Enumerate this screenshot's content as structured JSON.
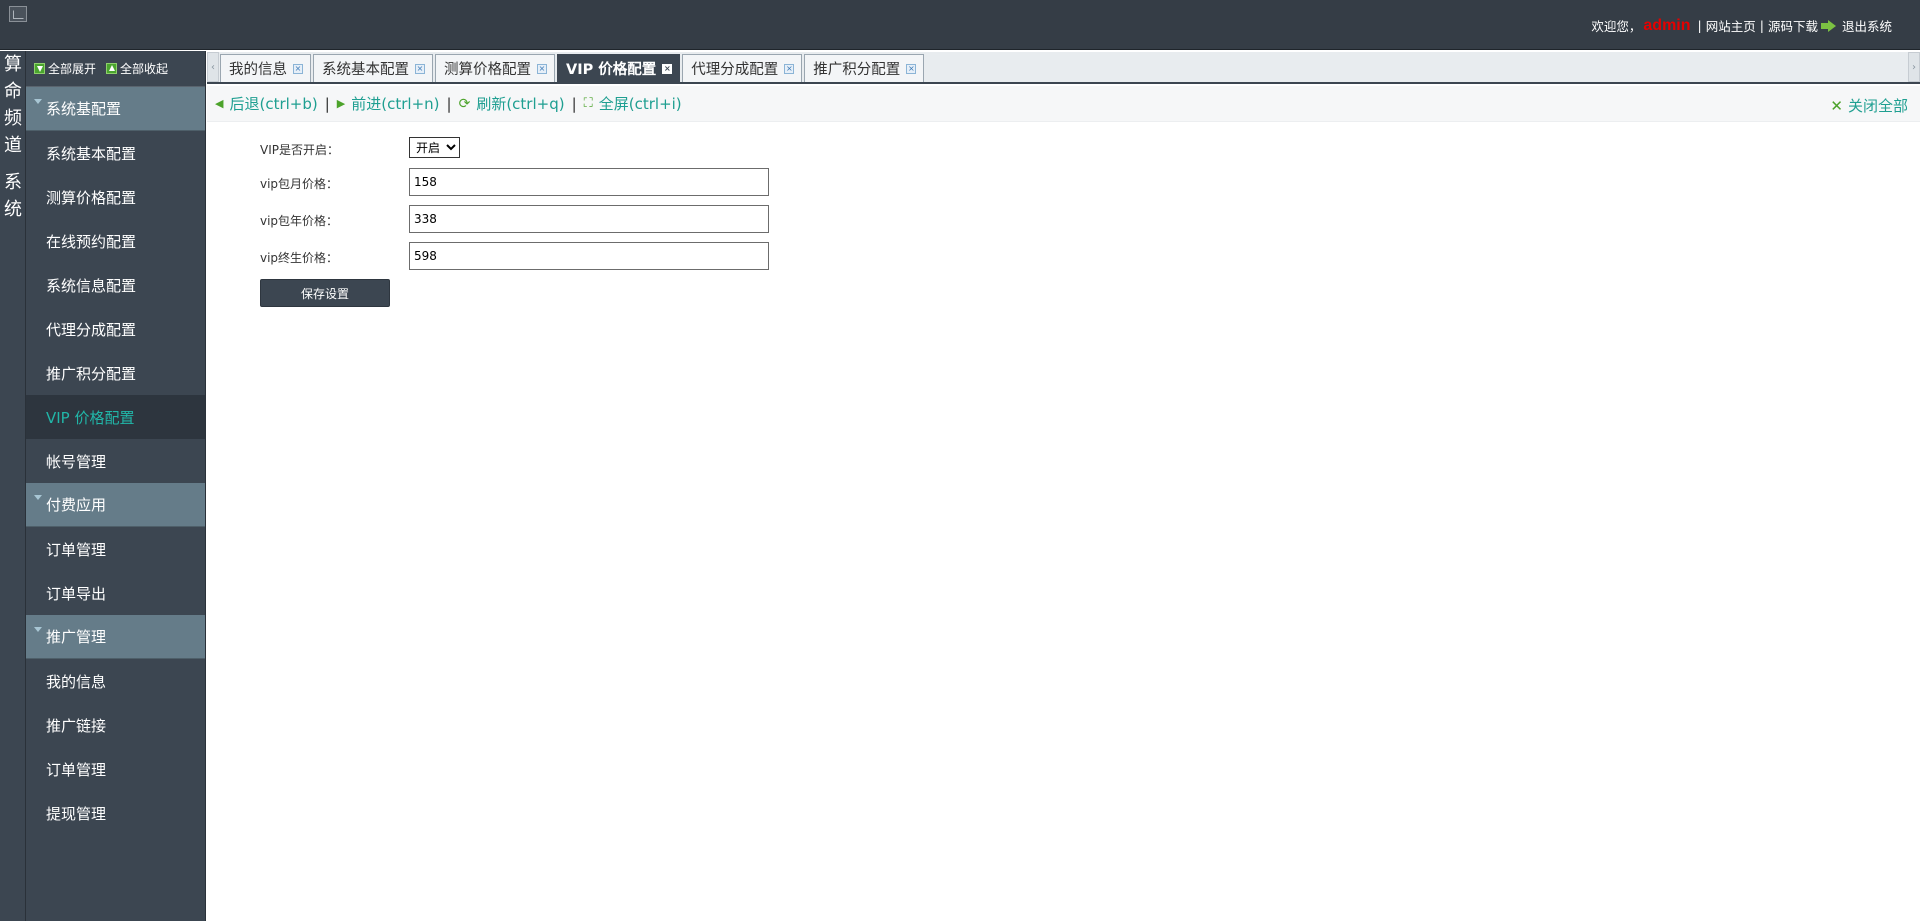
{
  "header": {
    "welcome": "欢迎您，",
    "user": "admin",
    "links": [
      "网站主页",
      "源码下载"
    ],
    "logout": "退出系统"
  },
  "channel": {
    "labels": [
      "算命频道",
      "系统"
    ]
  },
  "sidebar": {
    "expand_all": "全部展开",
    "collapse_all": "全部收起",
    "groups": [
      {
        "title": "系统基配置",
        "items": [
          "系统基本配置",
          "测算价格配置",
          "在线预约配置",
          "系统信息配置",
          "代理分成配置",
          "推广积分配置",
          "VIP 价格配置",
          "帐号管理"
        ]
      },
      {
        "title": "付费应用",
        "items": [
          "订单管理",
          "订单导出"
        ]
      },
      {
        "title": "推广管理",
        "items": [
          "我的信息",
          "推广链接",
          "订单管理",
          "提现管理"
        ]
      }
    ],
    "active_item": "VIP 价格配置"
  },
  "tabs": [
    {
      "label": "我的信息",
      "active": false
    },
    {
      "label": "系统基本配置",
      "active": false
    },
    {
      "label": "测算价格配置",
      "active": false
    },
    {
      "label": "VIP 价格配置",
      "active": true
    },
    {
      "label": "代理分成配置",
      "active": false
    },
    {
      "label": "推广积分配置",
      "active": false
    }
  ],
  "toolbar": {
    "back": "后退(ctrl+b)",
    "forward": "前进(ctrl+n)",
    "refresh": "刷新(ctrl+q)",
    "fullscreen": "全屏(ctrl+i)",
    "separator": "|",
    "close_all": "关闭全部"
  },
  "form": {
    "vip_enabled_label": "VIP是否开启：",
    "vip_enabled_value": "开启",
    "monthly_label": "vip包月价格：",
    "monthly_value": "158",
    "yearly_label": "vip包年价格：",
    "yearly_value": "338",
    "lifetime_label": "vip终生价格：",
    "lifetime_value": "598",
    "save_label": "保存设置"
  },
  "colors": {
    "header_bg": "#353d46",
    "sidebar_bg": "#3c4651",
    "group_bg": "#657c89",
    "active_text": "#21b6a8",
    "link_teal": "#1f9f91",
    "icon_green": "#4ca32b",
    "user_red": "#e60000"
  }
}
